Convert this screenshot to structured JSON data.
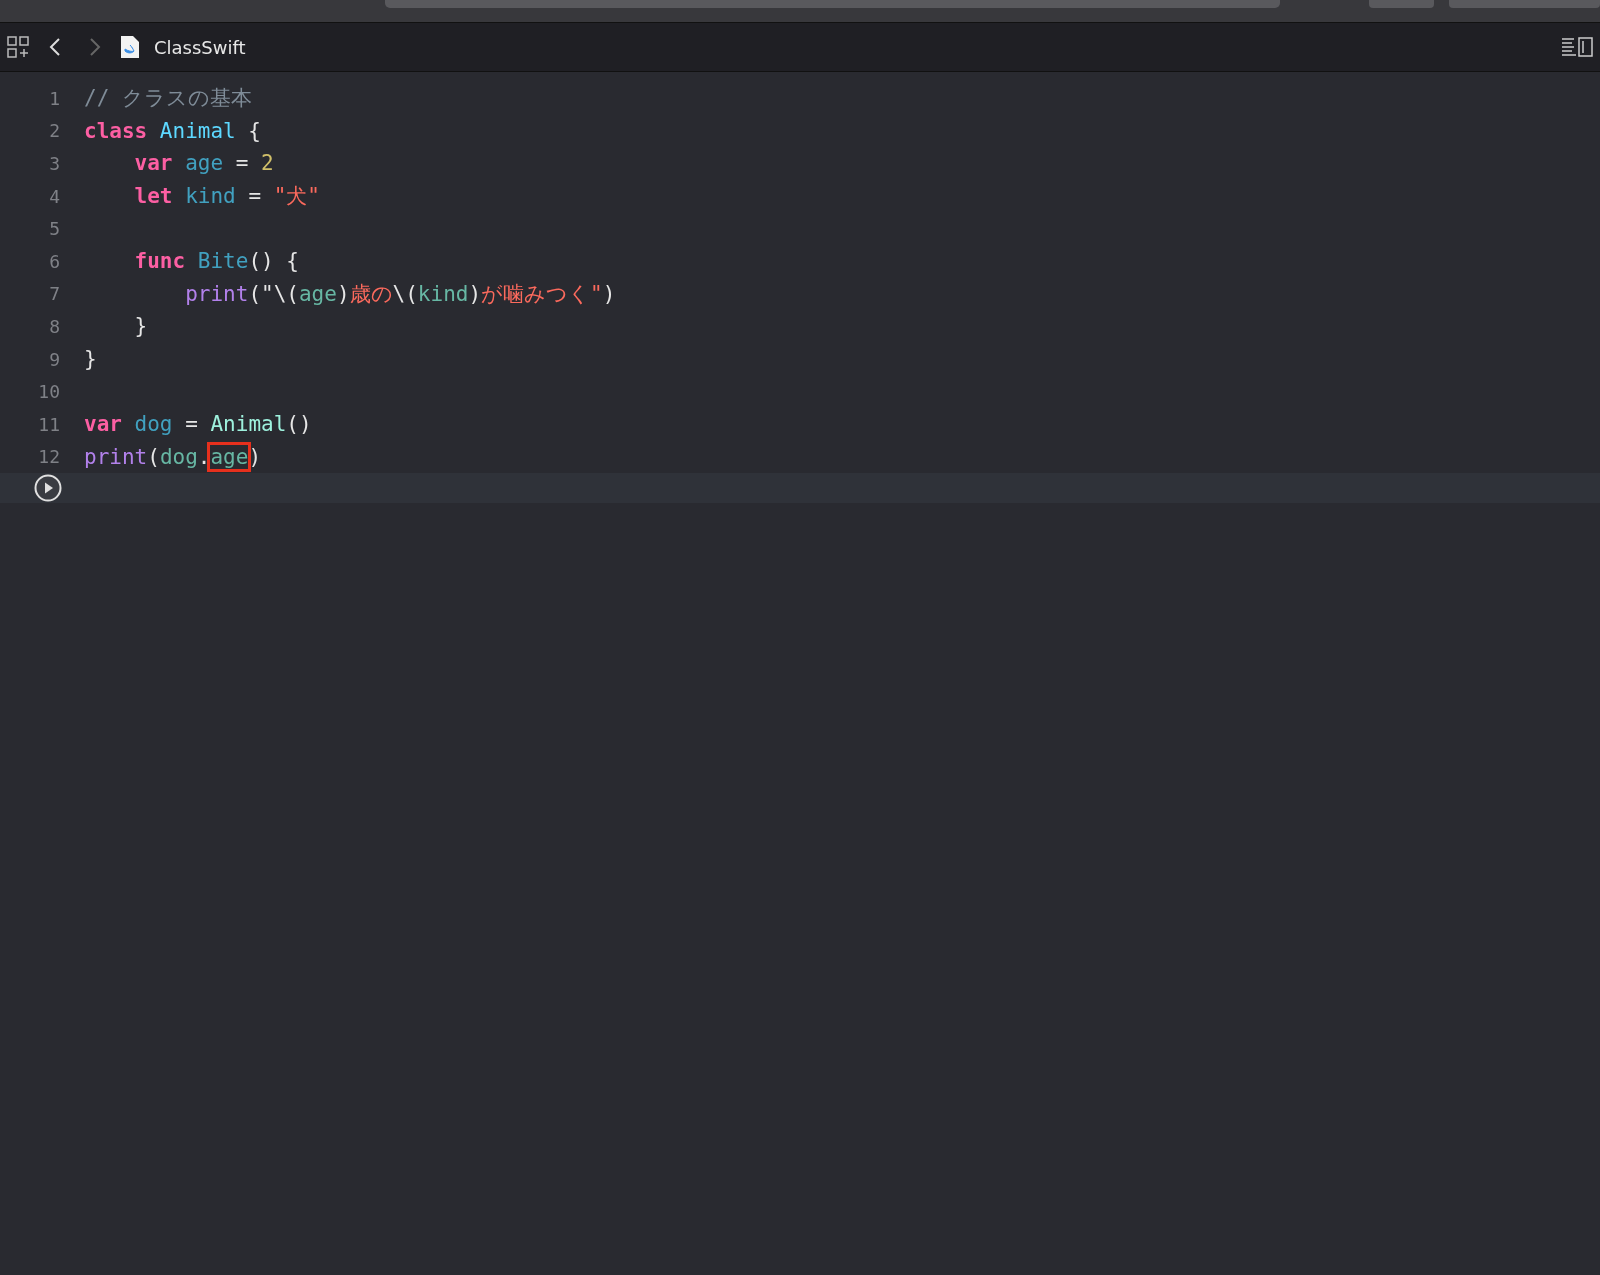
{
  "editor_bar": {
    "file_name": "ClassSwift"
  },
  "code": {
    "lines": [
      {
        "number": "1",
        "tokens": [
          {
            "text": "// クラスの基本",
            "kind": "comment"
          }
        ]
      },
      {
        "number": "2",
        "tokens": [
          {
            "text": "class ",
            "kind": "keyword"
          },
          {
            "text": "Animal",
            "kind": "type"
          },
          {
            "text": " {",
            "kind": "plain"
          }
        ]
      },
      {
        "number": "3",
        "tokens": [
          {
            "text": "    var ",
            "kind": "keyword"
          },
          {
            "text": "age",
            "kind": "decl"
          },
          {
            "text": " = ",
            "kind": "plain"
          },
          {
            "text": "2",
            "kind": "number"
          }
        ]
      },
      {
        "number": "4",
        "tokens": [
          {
            "text": "    let ",
            "kind": "keyword"
          },
          {
            "text": "kind",
            "kind": "decl"
          },
          {
            "text": " = ",
            "kind": "plain"
          },
          {
            "text": "\"犬\"",
            "kind": "string"
          }
        ]
      },
      {
        "number": "5"
      },
      {
        "number": "6",
        "tokens": [
          {
            "text": "    func ",
            "kind": "keyword"
          },
          {
            "text": "Bite",
            "kind": "decl"
          },
          {
            "text": "() {",
            "kind": "plain"
          }
        ]
      },
      {
        "number": "7",
        "tokens": [
          {
            "text": "        print",
            "kind": "call"
          },
          {
            "text": "(\"\\(",
            "kind": "plain"
          },
          {
            "text": "age",
            "kind": "ref"
          },
          {
            "text": ")",
            "kind": "plain"
          },
          {
            "text": "歳の",
            "kind": "string"
          },
          {
            "text": "\\(",
            "kind": "plain"
          },
          {
            "text": "kind",
            "kind": "ref"
          },
          {
            "text": ")",
            "kind": "plain"
          },
          {
            "text": "が噛みつく\"",
            "kind": "string"
          },
          {
            "text": ")",
            "kind": "plain"
          }
        ]
      },
      {
        "number": "8",
        "tokens": [
          {
            "text": "    }",
            "kind": "plain"
          }
        ]
      },
      {
        "number": "9",
        "tokens": [
          {
            "text": "}",
            "kind": "plain"
          }
        ]
      },
      {
        "number": "10"
      },
      {
        "number": "11",
        "tokens": [
          {
            "text": "var ",
            "kind": "keyword"
          },
          {
            "text": "dog",
            "kind": "decl"
          },
          {
            "text": " = ",
            "kind": "plain"
          },
          {
            "text": "Animal",
            "kind": "typeref"
          },
          {
            "text": "()",
            "kind": "plain"
          }
        ]
      },
      {
        "number": "12",
        "tokens": [
          {
            "text": "print",
            "kind": "call"
          },
          {
            "text": "(",
            "kind": "plain"
          },
          {
            "text": "dog",
            "kind": "ref"
          },
          {
            "text": ".",
            "kind": "plain"
          },
          {
            "text": "age",
            "kind": "ref",
            "boxed": true
          },
          {
            "text": ")",
            "kind": "plain"
          }
        ]
      }
    ]
  }
}
